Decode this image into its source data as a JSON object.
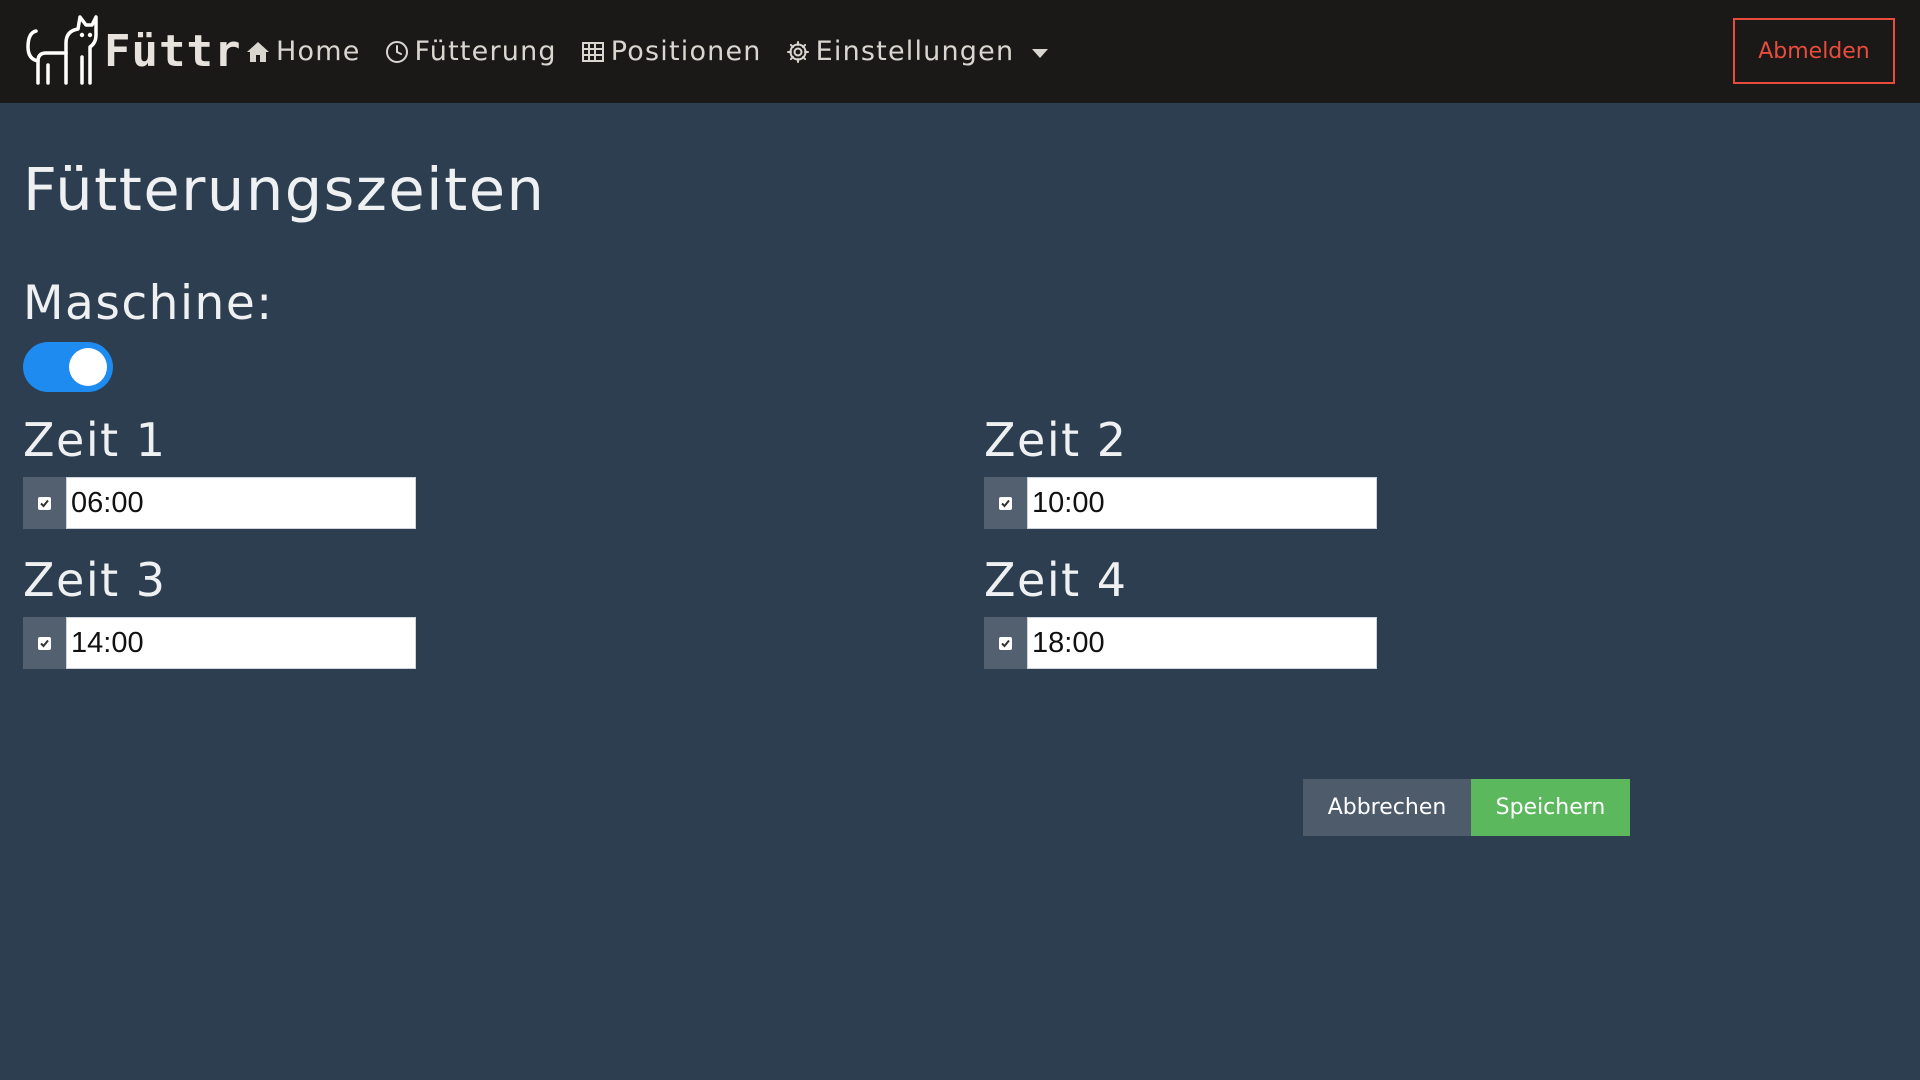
{
  "navbar": {
    "brand": "Füttr",
    "items": [
      {
        "label": "Home",
        "icon": "home-icon"
      },
      {
        "label": "Fütterung",
        "icon": "clock-icon"
      },
      {
        "label": "Positionen",
        "icon": "grid-icon"
      },
      {
        "label": "Einstellungen",
        "icon": "gear-icon"
      }
    ],
    "logout_label": "Abmelden"
  },
  "page": {
    "title": "Fütterungszeiten",
    "machine_label": "Maschine:",
    "machine_enabled": true
  },
  "times": [
    {
      "label": "Zeit 1",
      "value": "06:00",
      "enabled": true
    },
    {
      "label": "Zeit 2",
      "value": "10:00",
      "enabled": true
    },
    {
      "label": "Zeit 3",
      "value": "14:00",
      "enabled": true
    },
    {
      "label": "Zeit 4",
      "value": "18:00",
      "enabled": true
    }
  ],
  "actions": {
    "cancel_label": "Abbrechen",
    "save_label": "Speichern"
  },
  "colors": {
    "background": "#2c3e50",
    "navbar": "#1a1918",
    "toggle_on": "#1e8bf0",
    "logout": "#e74c3c",
    "save": "#5cb85c",
    "cancel": "#4d5b6b"
  }
}
